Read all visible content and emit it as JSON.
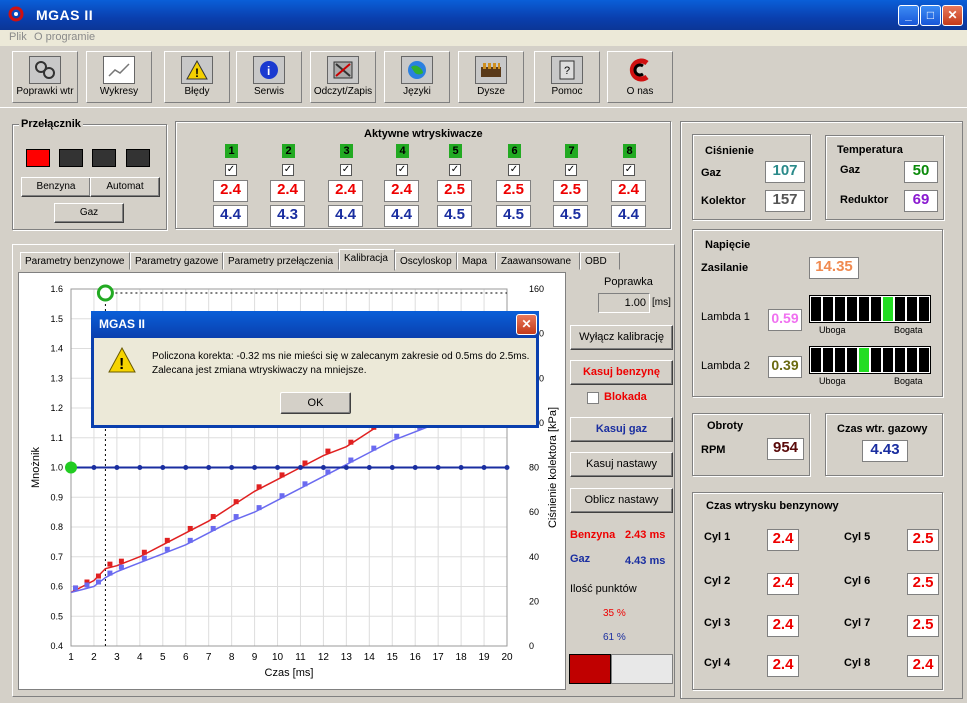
{
  "window": {
    "title": "MGAS II"
  },
  "menu": [
    "Plik",
    "O programie"
  ],
  "toolbar": [
    {
      "label": "Poprawki wtr",
      "icon": "tools-icon"
    },
    {
      "label": "Wykresy",
      "icon": "chart-icon"
    },
    {
      "label": "Błędy",
      "icon": "warning-icon"
    },
    {
      "label": "Serwis",
      "icon": "info-icon"
    },
    {
      "label": "Odczyt/Zapis",
      "icon": "read-write-icon"
    },
    {
      "label": "Języki",
      "icon": "globe-icon"
    },
    {
      "label": "Dysze",
      "icon": "nozzles-icon"
    },
    {
      "label": "Pomoc",
      "icon": "help-icon"
    },
    {
      "label": "O nas",
      "icon": "logo-icon"
    }
  ],
  "switch": {
    "title": "Przełącznik",
    "benzyna": "Benzyna",
    "automat": "Automat",
    "gaz": "Gaz"
  },
  "injectors": {
    "title": "Aktywne wtryskiwacze",
    "nums": [
      "1",
      "2",
      "3",
      "4",
      "5",
      "6",
      "7",
      "8"
    ],
    "benz": [
      "2.4",
      "2.4",
      "2.4",
      "2.4",
      "2.5",
      "2.5",
      "2.5",
      "2.4"
    ],
    "gas": [
      "4.4",
      "4.3",
      "4.4",
      "4.4",
      "4.5",
      "4.5",
      "4.5",
      "4.4"
    ]
  },
  "tabs": [
    "Parametry benzynowe",
    "Parametry gazowe",
    "Parametry przełączenia",
    "Kalibracja",
    "Oscyloskop",
    "Mapa",
    "Zaawansowane",
    "OBD"
  ],
  "calib": {
    "poprawka_label": "Poprawka",
    "poprawka_value": "1.00",
    "poprawka_unit": "[ms]",
    "btn_off": "Wyłącz kalibrację",
    "btn_kasuj_benz": "Kasuj benzynę",
    "blokada": "Blokada",
    "btn_kasuj_gaz": "Kasuj gaz",
    "btn_kasuj_nast": "Kasuj nastawy",
    "btn_oblicz": "Oblicz nastawy",
    "benzyna_label": "Benzyna",
    "benzyna_val": "2.43 ms",
    "gaz_label": "Gaz",
    "gaz_val": "4.43 ms",
    "points_label": "Ilość punktów",
    "pts_benz": "35 %",
    "pts_gaz": "61 %"
  },
  "chart_data": {
    "type": "line",
    "xlabel": "Czas [ms]",
    "ylabel": "Mnożnik",
    "y2label": "Ciśnienie kolektora [kPa]",
    "xlim": [
      1,
      20
    ],
    "ylim": [
      0.4,
      1.6
    ],
    "y2lim": [
      0,
      160
    ],
    "x_ticks": [
      "1",
      "2",
      "3",
      "4",
      "5",
      "6",
      "7",
      "8",
      "9",
      "10",
      "11",
      "12",
      "13",
      "14",
      "15",
      "16",
      "17",
      "18",
      "19",
      "20"
    ],
    "y_ticks": [
      "0.4",
      "0.5",
      "0.6",
      "0.7",
      "0.8",
      "0.9",
      "1.0",
      "1.1",
      "1.2",
      "1.3",
      "1.4",
      "1.5",
      "1.6"
    ],
    "y2_ticks": [
      "0",
      "20",
      "40",
      "60",
      "80",
      "100",
      "120",
      "140",
      "160"
    ],
    "series": [
      {
        "name": "Benzyna",
        "color": "#e02020",
        "x": [
          1,
          1.5,
          2,
          2.5,
          3,
          4,
          5,
          6,
          7,
          8,
          9,
          10,
          11,
          12,
          13,
          14,
          15,
          16
        ],
        "y": [
          0.58,
          0.6,
          0.62,
          0.66,
          0.67,
          0.7,
          0.74,
          0.78,
          0.82,
          0.87,
          0.92,
          0.96,
          1.0,
          1.04,
          1.07,
          1.12,
          1.17,
          1.2
        ]
      },
      {
        "name": "Gaz",
        "color": "#6a6af0",
        "x": [
          1,
          1.5,
          2,
          2.5,
          3,
          4,
          5,
          6,
          7,
          8,
          9,
          10,
          11,
          12,
          13,
          14,
          15,
          16,
          17
        ],
        "y": [
          0.58,
          0.59,
          0.6,
          0.63,
          0.65,
          0.68,
          0.71,
          0.74,
          0.78,
          0.82,
          0.85,
          0.89,
          0.93,
          0.97,
          1.01,
          1.05,
          1.09,
          1.12,
          1.15
        ]
      },
      {
        "name": "Mnożnik",
        "color": "#1a2ea0",
        "x": [
          1,
          2,
          3,
          4,
          5,
          6,
          7,
          8,
          9,
          10,
          11,
          12,
          13,
          14,
          15,
          16,
          17,
          18,
          19,
          20
        ],
        "y": [
          1.0,
          1.0,
          1.0,
          1.0,
          1.0,
          1.0,
          1.0,
          1.0,
          1.0,
          1.0,
          1.0,
          1.0,
          1.0,
          1.0,
          1.0,
          1.0,
          1.0,
          1.0,
          1.0,
          1.0
        ]
      }
    ]
  },
  "pressure": {
    "title": "Ciśnienie",
    "gaz_label": "Gaz",
    "gaz": "107",
    "kol_label": "Kolektor",
    "kol": "157"
  },
  "temp": {
    "title": "Temperatura",
    "gaz_label": "Gaz",
    "gaz": "50",
    "red_label": "Reduktor",
    "red": "69"
  },
  "voltage": {
    "title": "Napięcie",
    "zas_label": "Zasilanie",
    "zas": "14.35",
    "l1_label": "Lambda 1",
    "l1": "0.59",
    "l2_label": "Lambda 2",
    "l2": "0.39",
    "uboga": "Uboga",
    "bogata": "Bogata",
    "l1_level": 0.7,
    "l2_level": 0.4
  },
  "rpm": {
    "title": "Obroty",
    "label": "RPM",
    "value": "954"
  },
  "gas_time": {
    "title": "Czas wtr. gazowy",
    "value": "4.43"
  },
  "benz_time": {
    "title": "Czas wtrysku benzynowy",
    "cyl": [
      {
        "label": "Cyl 1",
        "v": "2.4"
      },
      {
        "label": "Cyl 2",
        "v": "2.4"
      },
      {
        "label": "Cyl 3",
        "v": "2.4"
      },
      {
        "label": "Cyl 4",
        "v": "2.4"
      },
      {
        "label": "Cyl 5",
        "v": "2.5"
      },
      {
        "label": "Cyl 6",
        "v": "2.5"
      },
      {
        "label": "Cyl 7",
        "v": "2.5"
      },
      {
        "label": "Cyl 8",
        "v": "2.4"
      }
    ]
  },
  "dialog": {
    "title": "MGAS II",
    "line1": "Policzona korekta: -0.32 ms nie mieści się w zalecanym zakresie od 0.5ms do 2.5ms.",
    "line2": "Zalecana jest zmiana wtryskiwaczy na mniejsze.",
    "ok": "OK"
  }
}
